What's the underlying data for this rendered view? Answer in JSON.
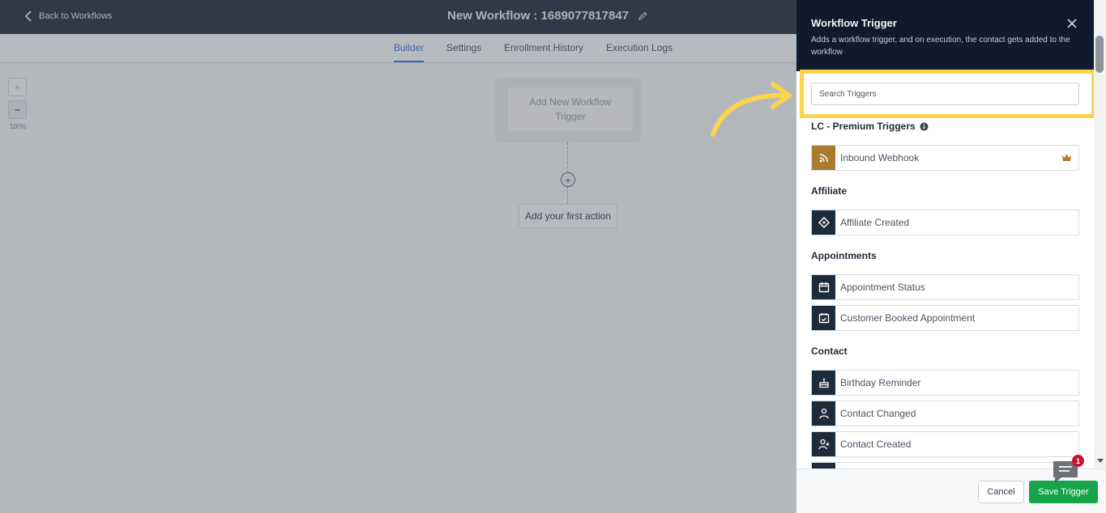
{
  "topbar": {
    "back_label": "Back to Workflows",
    "workflow_title": "New Workflow : 1689077817847"
  },
  "tabs": [
    {
      "label": "Builder",
      "active": true
    },
    {
      "label": "Settings",
      "active": false
    },
    {
      "label": "Enrollment History",
      "active": false
    },
    {
      "label": "Execution Logs",
      "active": false
    }
  ],
  "canvas": {
    "zoom_in_label": "+",
    "zoom_out_label": "−",
    "zoom_level": "100%",
    "trigger_placeholder": "Add New Workflow Trigger",
    "add_action_label": "Add your first action",
    "add_icon": "+"
  },
  "panel": {
    "title": "Workflow Trigger",
    "description": "Adds a workflow trigger, and on execution, the contact gets added to the workflow",
    "search_placeholder": "Search Triggers",
    "highlight_color": "#fcd34d",
    "sections": [
      {
        "title": "LC - Premium Triggers",
        "has_info": true,
        "items": [
          {
            "label": "Inbound Webhook",
            "icon": "rss-icon",
            "premium": true
          }
        ]
      },
      {
        "title": "Affiliate",
        "items": [
          {
            "label": "Affiliate Created",
            "icon": "tag-icon"
          }
        ]
      },
      {
        "title": "Appointments",
        "items": [
          {
            "label": "Appointment Status",
            "icon": "calendar-icon"
          },
          {
            "label": "Customer Booked Appointment",
            "icon": "calendar-check-icon"
          }
        ]
      },
      {
        "title": "Contact",
        "items": [
          {
            "label": "Birthday Reminder",
            "icon": "cake-icon"
          },
          {
            "label": "Contact Changed",
            "icon": "users-icon"
          },
          {
            "label": "Contact Created",
            "icon": "user-plus-icon"
          }
        ]
      }
    ]
  },
  "footer": {
    "cancel_label": "Cancel",
    "save_label": "Save Trigger"
  },
  "chat": {
    "badge_count": "1"
  },
  "colors": {
    "header_bg": "#0f1b2d",
    "save_green": "#16a34a",
    "tab_active": "#2563eb",
    "premium_icon": "#a97b2c"
  }
}
